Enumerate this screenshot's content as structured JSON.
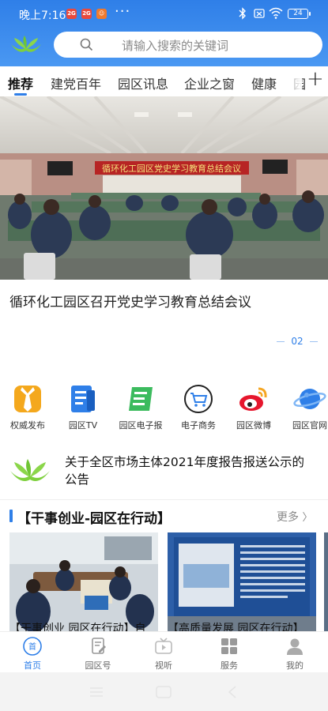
{
  "status": {
    "time": "晚上7:16",
    "badges": [
      "2G",
      "2G",
      "☺"
    ],
    "more": "···",
    "battery": "24"
  },
  "search": {
    "placeholder": "请输入搜索的关键词"
  },
  "tabs": [
    {
      "label": "推荐"
    },
    {
      "label": "建党百年"
    },
    {
      "label": "园区讯息"
    },
    {
      "label": "企业之窗"
    },
    {
      "label": "健康"
    },
    {
      "label": "园"
    }
  ],
  "tabs_add": "+",
  "hero": {
    "banner_text": "循环化工园区党史学习教育总结会议",
    "title": "循环化工园区召开党史学习教育总结会议",
    "pager": "02"
  },
  "quick_links": [
    {
      "label": "权威发布",
      "icon": "tie-icon",
      "color": "#f0a11a"
    },
    {
      "label": "园区TV",
      "icon": "document-icon",
      "color": "#2f7fe8"
    },
    {
      "label": "园区电子报",
      "icon": "scroll-icon",
      "color": "#36b55a"
    },
    {
      "label": "电子商务",
      "icon": "cart-icon",
      "color": "#2f7fe8"
    },
    {
      "label": "园区微博",
      "icon": "weibo-icon",
      "color": "#e6162d"
    },
    {
      "label": "园区官网",
      "icon": "planet-icon",
      "color": "#2f7fe8"
    }
  ],
  "notice": {
    "text": "关于全区市场主体2021年度报告报送公示的公告"
  },
  "section": {
    "title": "【干事创业-园区在行动】",
    "more": "更多"
  },
  "cards": [
    {
      "caption": "【干事创业 园区在行动】自"
    },
    {
      "caption": "【高质量发展 园区在行动】"
    }
  ],
  "bottom_nav": [
    {
      "label": "首页",
      "icon": "home-icon"
    },
    {
      "label": "园区号",
      "icon": "edit-doc-icon"
    },
    {
      "label": "视听",
      "icon": "tv-icon"
    },
    {
      "label": "服务",
      "icon": "grid-icon"
    },
    {
      "label": "我的",
      "icon": "user-icon"
    }
  ],
  "colors": {
    "accent": "#2f7fe8",
    "header": "#3b8bee"
  }
}
